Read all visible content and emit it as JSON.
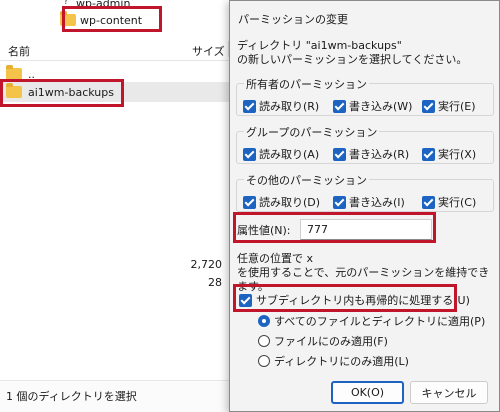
{
  "tree": {
    "items": [
      {
        "icon": "unknown-file-icon",
        "label": "wp-admin"
      },
      {
        "icon": "folder-icon",
        "label": "wp-content"
      }
    ]
  },
  "file_list": {
    "columns": {
      "name": "名前",
      "size": "サイズ"
    },
    "rows": [
      {
        "icon": "folder-icon",
        "name": "..",
        "size": ""
      },
      {
        "icon": "folder-icon",
        "name": "ai1wm-backups",
        "size": ""
      }
    ],
    "size_values": [
      "2,720",
      "28"
    ]
  },
  "status_bar": {
    "text": "1 個のディレクトリを選択"
  },
  "dialog": {
    "title": "パーミッションの変更",
    "description_line1": "ディレクトリ \"ai1wm-backups\"",
    "description_line2": "の新しいパーミッションを選択してください。",
    "owner": {
      "title": "所有者のパーミッション",
      "read": "読み取り(R)",
      "write": "書き込み(W)",
      "exec": "実行(E)"
    },
    "group": {
      "title": "グループのパーミッション",
      "read": "読み取り(A)",
      "write": "書き込み(R)",
      "exec": "実行(X)"
    },
    "other": {
      "title": "その他のパーミッション",
      "read": "読み取り(D)",
      "write": "書き込み(I)",
      "exec": "実行(C)"
    },
    "numeric_label": "属性値(N):",
    "numeric_value": "777",
    "note_line1": "任意の位置で x",
    "note_line2": "を使用することで、元のパーミッションを維持できます。",
    "recurse_label": "サブディレクトリ内も再帰的に処理する(U)",
    "radios": {
      "all": "すべてのファイルとディレクトリに適用(P)",
      "files": "ファイルにのみ適用(F)",
      "dirs": "ディレクトリにのみ適用(L)"
    },
    "ok_label": "OK(O)",
    "cancel_label": "キャンセル"
  },
  "colors": {
    "accent": "#1d63c2",
    "highlight": "#c0152a"
  }
}
